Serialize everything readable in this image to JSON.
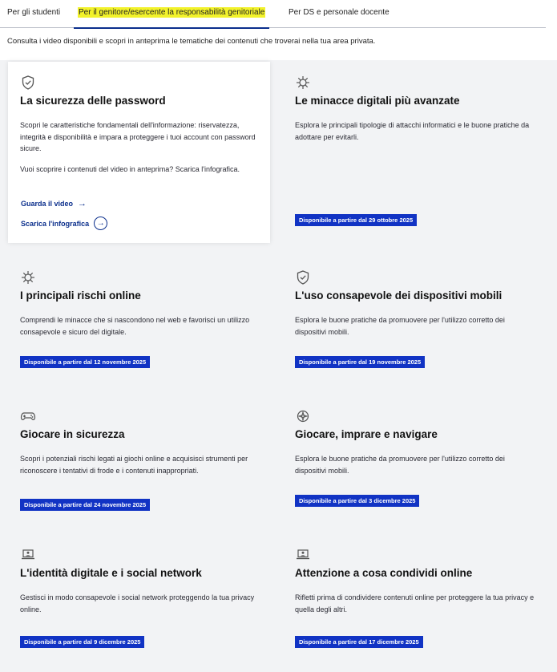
{
  "tabs": {
    "students": "Per gli studenti",
    "parents": "Per il genitore/esercente la responsabilità genitoriale",
    "staff": "Per DS e personale docente"
  },
  "intro": "Consulta i video disponibili e scopri in anteprima le tematiche dei contenuti che troverai nella tua area privata.",
  "cards": [
    {
      "icon": "shield-icon",
      "title": "La sicurezza delle password",
      "description": "Scopri le caratteristiche fondamentali dell'informazione: riservatezza, integrità e disponibilità e impara a proteggere i tuoi account con password sicure.",
      "preview": "Vuoi scoprire i contenuti del video in anteprima? Scarica l'infografica.",
      "watch_label": "Guarda il video",
      "download_label": "Scarica l'infografica"
    },
    {
      "icon": "virus-icon",
      "title": "Le minacce digitali più avanzate",
      "description": "Esplora le principali tipologie di attacchi informatici e le buone pratiche da adottare per evitarli.",
      "badge": "Disponibile a partire dal 29 ottobre 2025"
    },
    {
      "icon": "virus-icon",
      "title": "I principali rischi online",
      "description": "Comprendi le minacce che si nascondono nel web e favorisci un utilizzo consapevole e sicuro del digitale.",
      "badge": "Disponibile a partire dal 12 novembre 2025"
    },
    {
      "icon": "shield-icon",
      "title": "L'uso consapevole dei dispositivi mobili",
      "description": "Esplora le buone pratiche da promuovere per l'utilizzo corretto dei dispositivi mobili.",
      "badge": "Disponibile a partire dal 19 novembre 2025"
    },
    {
      "icon": "gamepad-icon",
      "title": "Giocare in sicurezza",
      "description": "Scopri i potenziali rischi legati ai giochi online e acquisisci strumenti per riconoscere i tentativi di frode e i contenuti inappropriati.",
      "badge": "Disponibile a partire dal 24 novembre 2025"
    },
    {
      "icon": "compass-icon",
      "title": "Giocare, imprare e navigare",
      "description": "Esplora le buone pratiche da promuovere per l'utilizzo corretto dei dispositivi mobili.",
      "badge": "Disponibile a partire dal 3 dicembre 2025"
    },
    {
      "icon": "laptop-user-icon",
      "title": "L'identità digitale e i social network",
      "description": "Gestisci in modo consapevole i social network proteggendo la tua privacy online.",
      "badge": "Disponibile a partire dal 9 dicembre 2025"
    },
    {
      "icon": "laptop-user-icon",
      "title": "Attenzione a cosa condividi online",
      "description": "Rifletti prima di condividere contenuti online per proteggere la tua privacy e quella degli altri.",
      "badge": "Disponibile a partire dal 17 dicembre 2025"
    }
  ]
}
